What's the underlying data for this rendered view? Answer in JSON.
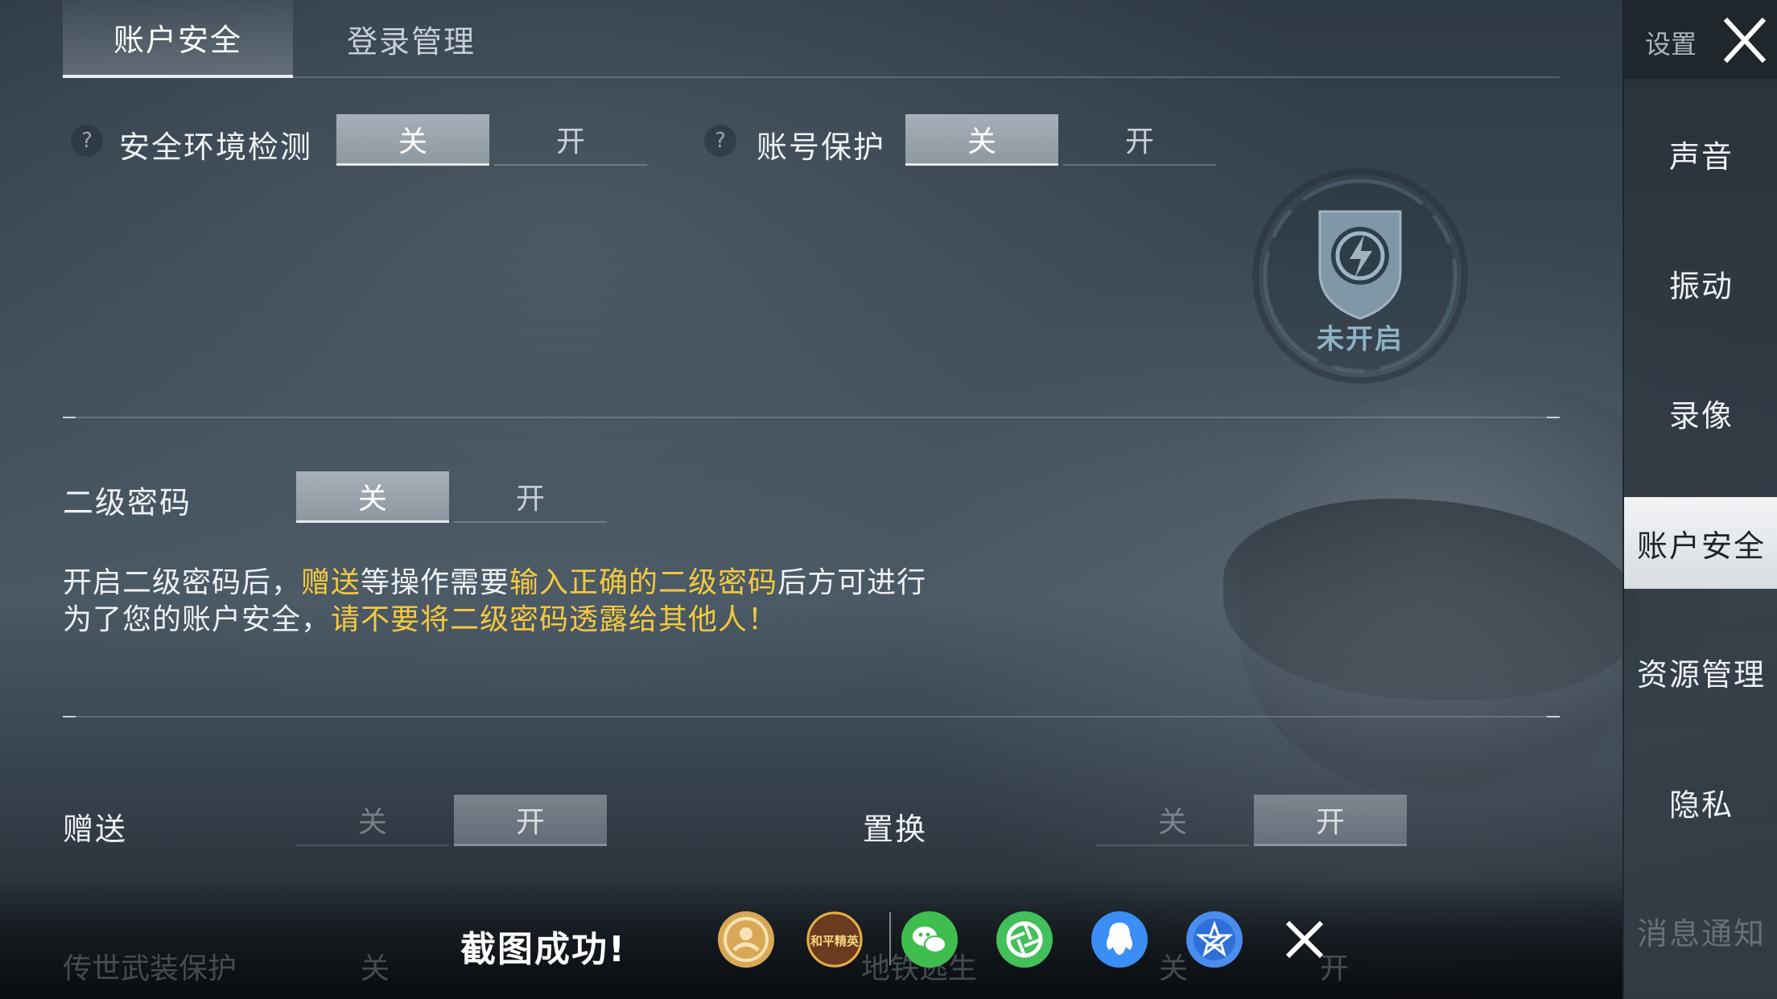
{
  "tabs": [
    {
      "label": "账户安全",
      "active": true
    },
    {
      "label": "登录管理",
      "active": false
    }
  ],
  "security_env": {
    "label": "安全环境检测",
    "help": "?",
    "off": "关",
    "on": "开",
    "state": "off"
  },
  "account_protect": {
    "label": "账号保护",
    "help": "?",
    "off": "关",
    "on": "开",
    "state": "off"
  },
  "badge": {
    "status": "未开启",
    "icon": "lightning-shield-icon"
  },
  "second_password": {
    "label": "二级密码",
    "off": "关",
    "on": "开",
    "state": "off"
  },
  "description": {
    "line1": [
      {
        "text": "开启二级密码后，",
        "highlight": false
      },
      {
        "text": "赠送",
        "highlight": true
      },
      {
        "text": "等操作需要",
        "highlight": false
      },
      {
        "text": "输入正确的二级密码",
        "highlight": true
      },
      {
        "text": "后方可进行",
        "highlight": false
      }
    ],
    "line2": [
      {
        "text": "为了您的账户安全，",
        "highlight": false
      },
      {
        "text": "请不要将二级密码透露给其他人！",
        "highlight": true
      }
    ]
  },
  "gift": {
    "label": "赠送",
    "off": "关",
    "on": "开",
    "state": "on"
  },
  "exchange": {
    "label": "置换",
    "off": "关",
    "on": "开",
    "state": "on"
  },
  "bottom_faded": {
    "label": "传世武装保护",
    "off": "关",
    "middle": "地铁逃生",
    "right_off": "关",
    "right_on": "开"
  },
  "sidebar": {
    "title": "设置",
    "items": [
      {
        "label": "声音",
        "active": false
      },
      {
        "label": "振动",
        "active": false
      },
      {
        "label": "录像",
        "active": false
      },
      {
        "label": "账户安全",
        "active": true
      },
      {
        "label": "资源管理",
        "active": false
      },
      {
        "label": "隐私",
        "active": false
      },
      {
        "label": "消息通知",
        "active": false
      }
    ]
  },
  "screenshot_bar": {
    "message": "截图成功!",
    "share_targets": [
      "friend-circle-icon",
      "peace-elite-icon",
      "wechat-icon",
      "moments-icon",
      "qq-icon",
      "qzone-icon",
      "close-icon"
    ],
    "peace_elite_text": "和平精英"
  },
  "colors": {
    "highlight": "#f4c93f",
    "active_toggle": "#9aa3ab",
    "wechat": "#3fbe4f",
    "qq": "#3a8ef5"
  }
}
